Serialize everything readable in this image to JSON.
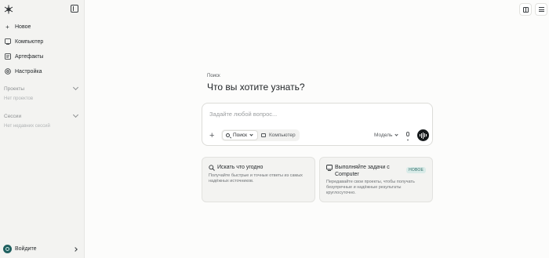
{
  "sidebar": {
    "items": [
      {
        "label": "Новое",
        "icon": "plus-icon"
      },
      {
        "label": "Компьютер",
        "icon": "computer-icon"
      },
      {
        "label": "Артефакты",
        "icon": "artifacts-icon"
      },
      {
        "label": "Настройка",
        "icon": "settings-icon"
      }
    ],
    "projects": {
      "label": "Проекты",
      "empty": "Нет проектов"
    },
    "sessions": {
      "label": "Сессии",
      "empty": "Нет недавних сессий"
    },
    "login": {
      "label": "Войдите"
    }
  },
  "main": {
    "kicker": "Поиск",
    "headline": "Что вы хотите узнать?",
    "composer": {
      "placeholder": "Задайте любой вопрос...",
      "mode_search": "Поиск",
      "mode_computer": "Компьютер",
      "model_label": "Модель"
    },
    "cards": [
      {
        "title": "Искать что угодно",
        "desc_line1": "Получайте быстрые и точные ответы из самых",
        "desc_line2": "надёжных источников."
      },
      {
        "title_line1": "Выполняйте задачи с",
        "title_line2": "Computer",
        "badge": "НОВОЕ",
        "desc_line1": "Передавайте свои проекты, чтобы получать",
        "desc_line2": "безупречные и надёжные результаты",
        "desc_line3": "круглосуточно."
      }
    ]
  },
  "colors": {
    "accent": "#1f5f5f",
    "badge_bg": "#d9ebe8",
    "voice_button": "#15191b"
  }
}
